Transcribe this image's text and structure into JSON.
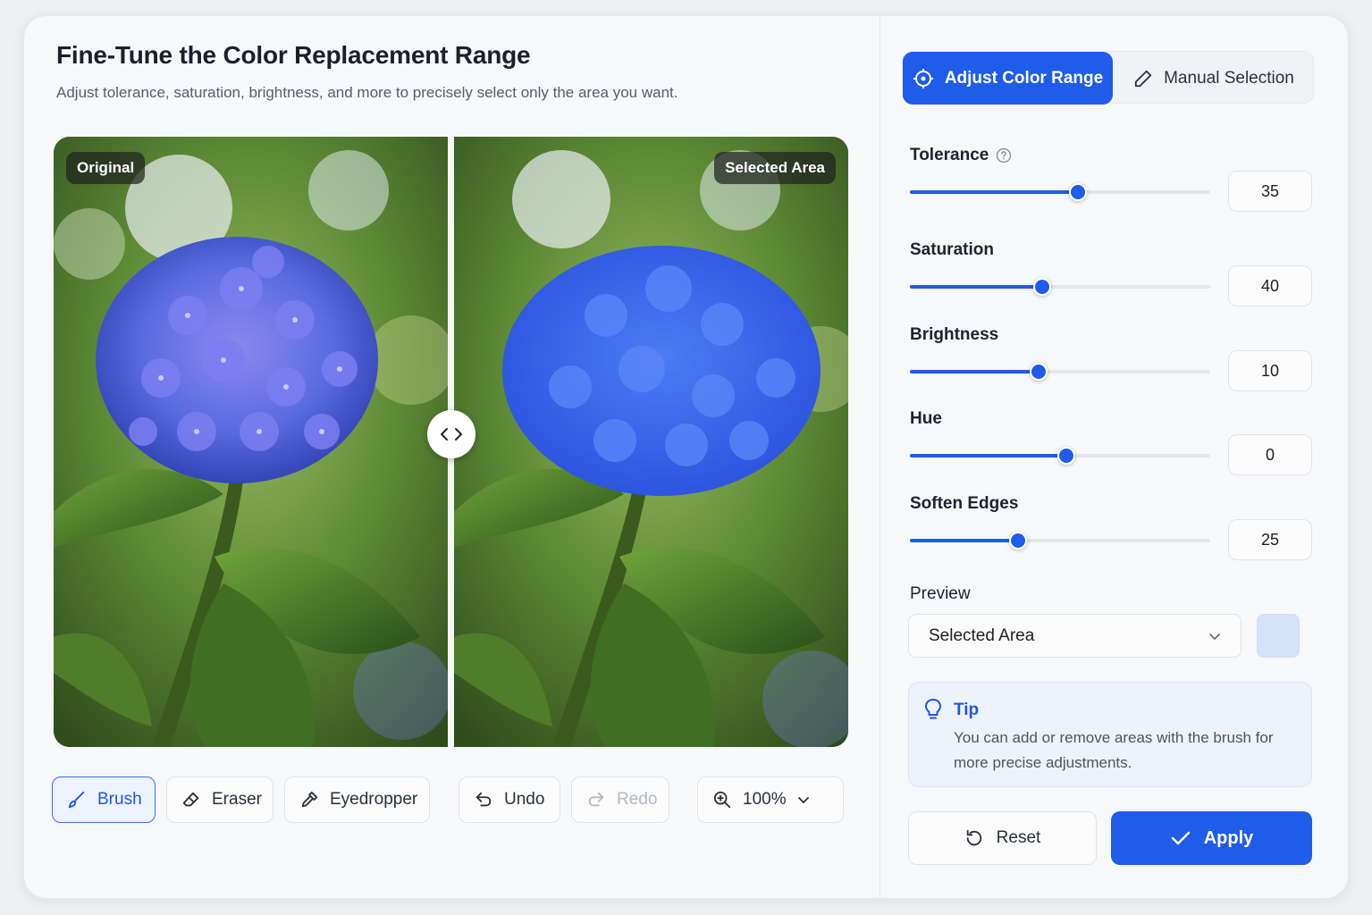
{
  "header": {
    "title": "Fine-Tune the Color Replacement Range",
    "subtitle": "Adjust tolerance, saturation, brightness, and more to precisely select only the area you want."
  },
  "viewer": {
    "original_label": "Original",
    "selected_label": "Selected Area",
    "split_handle_icon": "chevron-left-right-icon"
  },
  "toolbar": {
    "brush": "Brush",
    "eraser": "Eraser",
    "eyedropper": "Eyedropper",
    "undo": "Undo",
    "redo": "Redo",
    "zoom": "100%"
  },
  "tabs": {
    "adjust": "Adjust Color Range",
    "manual": "Manual Selection"
  },
  "sliders": [
    {
      "label": "Tolerance",
      "value": "35",
      "level": 0.56,
      "help": true
    },
    {
      "label": "Saturation",
      "value": "40",
      "level": 0.44,
      "help": false
    },
    {
      "label": "Brightness",
      "value": "10",
      "level": 0.43,
      "help": false
    },
    {
      "label": "Hue",
      "value": "0",
      "level": 0.52,
      "help": false
    },
    {
      "label": "Soften Edges",
      "value": "25",
      "level": 0.36,
      "help": false
    }
  ],
  "preview": {
    "label": "Preview",
    "selected": "Selected Area",
    "swatch_color": "#d6e1fa"
  },
  "tip": {
    "title": "Tip",
    "body": "You can add or remove areas with the brush for more precise adjustments."
  },
  "actions": {
    "reset": "Reset",
    "apply": "Apply"
  },
  "colors": {
    "accent": "#1f5ce8"
  }
}
